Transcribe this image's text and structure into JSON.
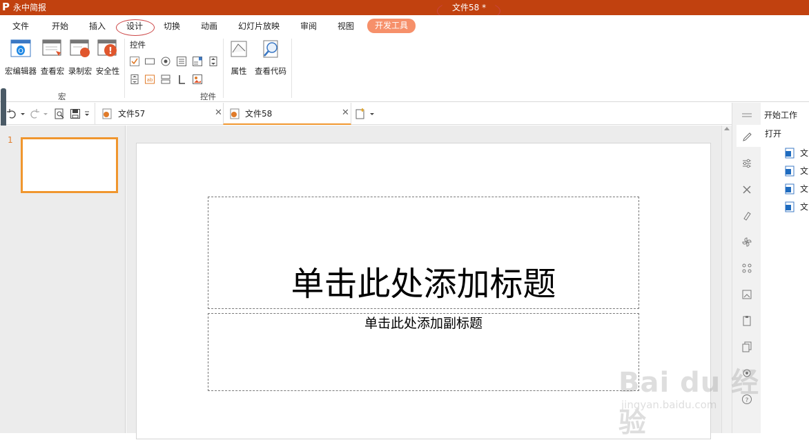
{
  "app": {
    "name": "永中简报",
    "document_title": "文件58 *",
    "logo_letter": "P"
  },
  "menu": {
    "items": [
      "文件",
      "开始",
      "插入",
      "设计",
      "切换",
      "动画",
      "幻灯片放映",
      "审阅",
      "视图"
    ],
    "active": "开发工具"
  },
  "ribbon": {
    "macro_group": {
      "label": "宏",
      "buttons": [
        "宏编辑器",
        "查看宏",
        "录制宏",
        "安全性"
      ]
    },
    "controls_group": {
      "title": "控件",
      "label": "控件"
    },
    "properties_group": {
      "buttons": [
        "属性",
        "查看代码"
      ]
    }
  },
  "tabs": [
    {
      "label": "文件57"
    },
    {
      "label": "文件58"
    }
  ],
  "slides_panel": {
    "slide_number": "1"
  },
  "slide": {
    "title_placeholder": "单击此处添加标题",
    "subtitle_placeholder": "单击此处添加副标题"
  },
  "task_pane": {
    "header": "开始工作",
    "open_label": "打开",
    "recent_files": [
      "文",
      "文",
      "文",
      "文"
    ]
  },
  "watermark": {
    "text": "Bai du 经验",
    "sub": "jingyan.baidu.com"
  },
  "colors": {
    "titlebar": "#c1410f",
    "active_tab": "#f6906a",
    "thumb_border": "#f0962e"
  }
}
